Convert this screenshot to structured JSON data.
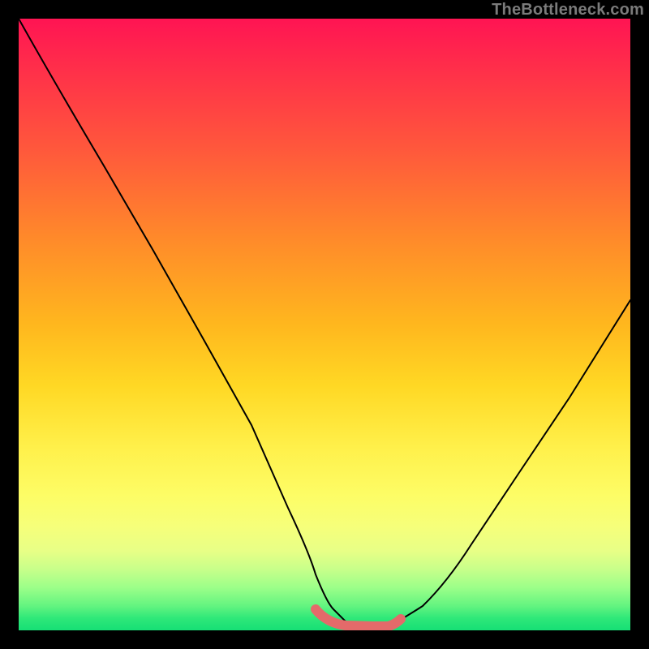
{
  "watermark": "TheBottleneck.com",
  "chart_data": {
    "type": "line",
    "title": "",
    "xlabel": "",
    "ylabel": "",
    "xlim": [
      0,
      100
    ],
    "ylim": [
      0,
      100
    ],
    "grid": false,
    "legend": false,
    "series": [
      {
        "name": "black-curve",
        "color": "#000000",
        "x": [
          0,
          6,
          14,
          22,
          30,
          38,
          44,
          48.5,
          51.5,
          58,
          60.5,
          66,
          74,
          82,
          90,
          100
        ],
        "y": [
          100,
          90,
          76,
          62,
          48,
          33,
          20,
          9,
          3.5,
          0.6,
          0.6,
          4,
          14,
          26,
          38,
          54
        ]
      },
      {
        "name": "red-floor",
        "color": "#e46a6a",
        "x": [
          48.5,
          51.5,
          58,
          60.5
        ],
        "y": [
          3.5,
          0.6,
          0.6,
          4
        ]
      }
    ]
  }
}
